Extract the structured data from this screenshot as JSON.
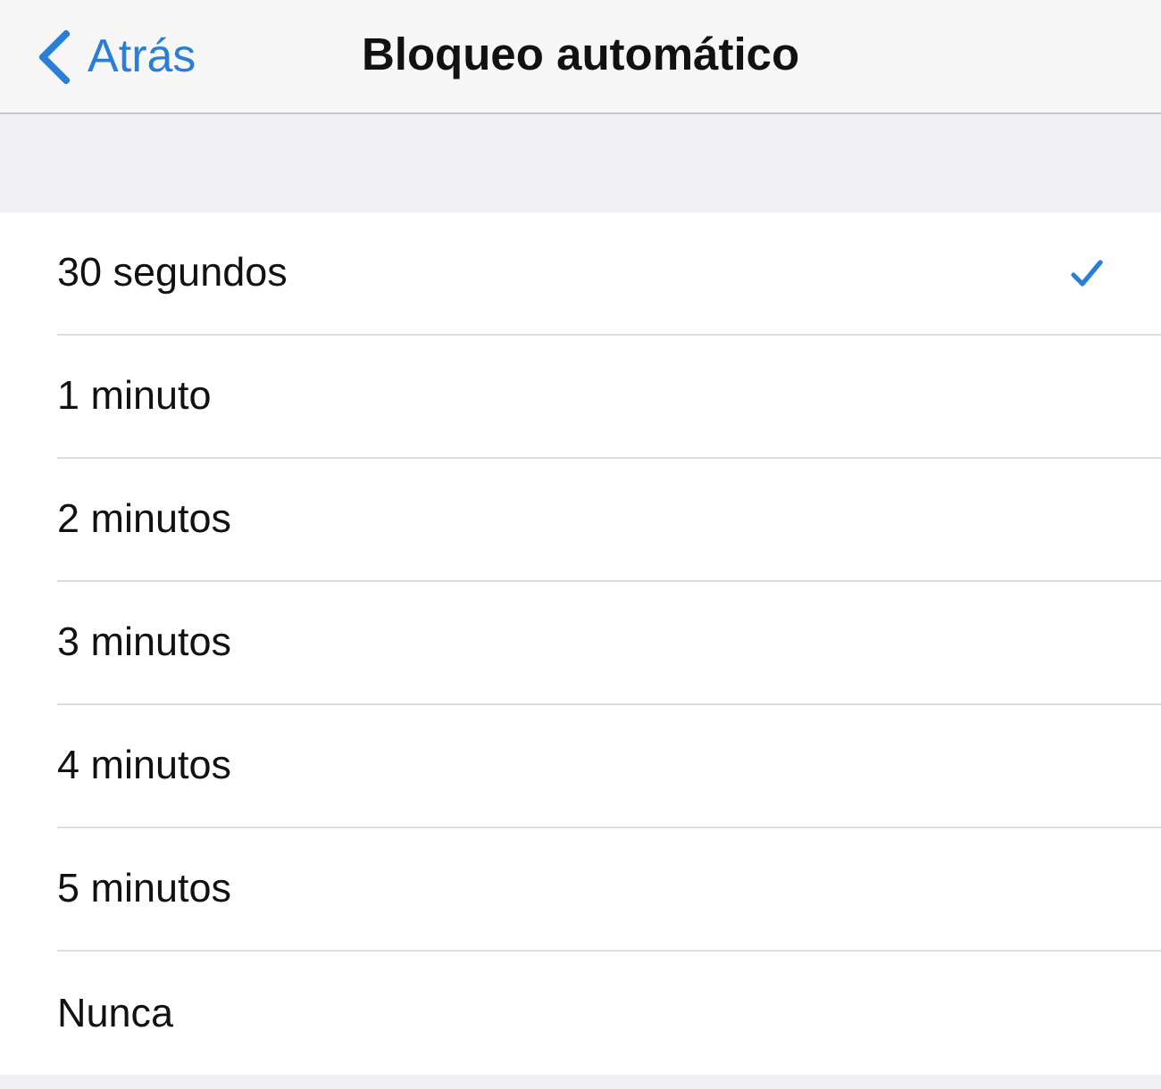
{
  "nav_bar": {
    "back_label": "Atrás",
    "title": "Bloqueo automático"
  },
  "options": [
    {
      "label": "30 segundos",
      "selected": true
    },
    {
      "label": "1 minuto",
      "selected": false
    },
    {
      "label": "2 minutos",
      "selected": false
    },
    {
      "label": "3 minutos",
      "selected": false
    },
    {
      "label": "4 minutos",
      "selected": false
    },
    {
      "label": "5 minutos",
      "selected": false
    },
    {
      "label": "Nunca",
      "selected": false
    }
  ]
}
